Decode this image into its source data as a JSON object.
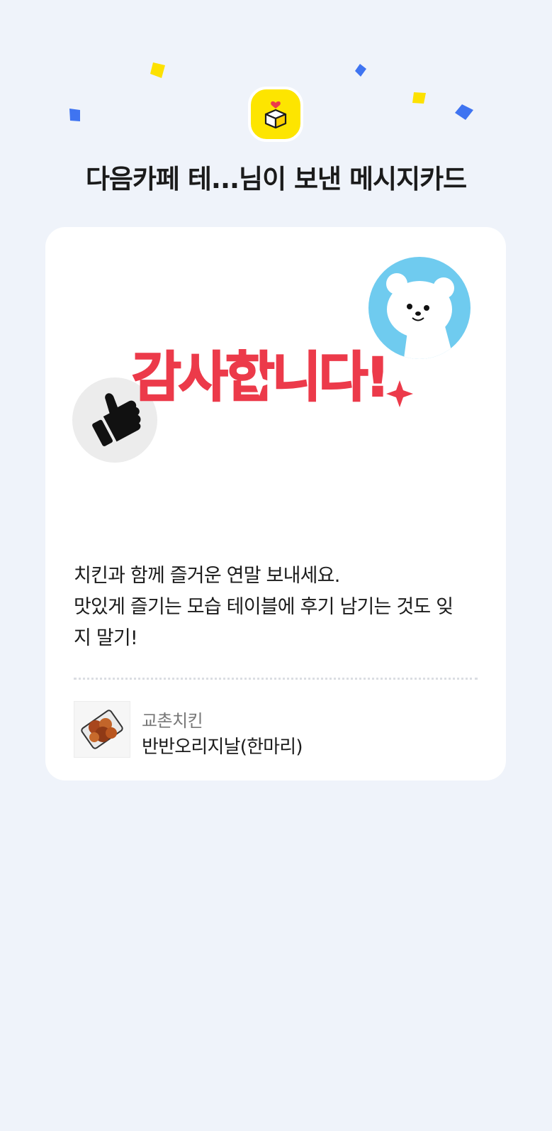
{
  "header": {
    "title": "다음카페 테...님이 보낸 메시지카드",
    "icon": "gift-box-heart-icon"
  },
  "card": {
    "headline": "감사합니다!",
    "message_lines": [
      "치킨과 함께 즐거운 연말 보내세요.",
      "맛있게 즐기는 모습 테이블에 후기 남기는 것도 잊",
      "지 말기!"
    ],
    "product": {
      "brand": "교촌치킨",
      "name": "반반오리지날(한마리)"
    }
  },
  "colors": {
    "background": "#eff3fa",
    "accent_yellow": "#fde500",
    "headline_red": "#ec3a4a",
    "confetti_blue": "#3f74f1",
    "bear_circle": "#6fcbef"
  }
}
